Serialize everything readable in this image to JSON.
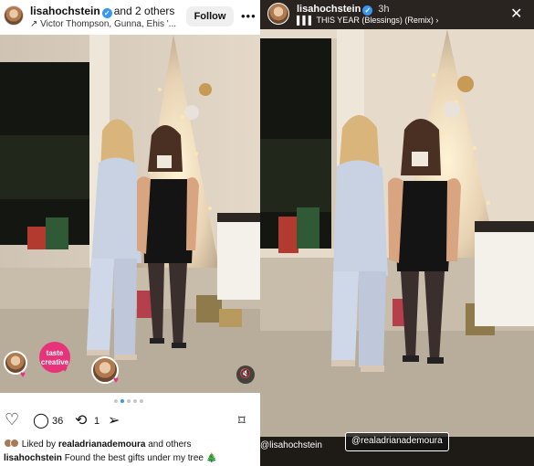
{
  "post": {
    "username": "lisahochstein",
    "others": "and 2 others",
    "subtitle": "Victor Thompson, Gunna, Ehis '...",
    "follow_label": "Follow",
    "more_icon": "more-horizontal-icon",
    "sticker_label": "taste\ncreative",
    "likes_count": "36",
    "comments_count": "",
    "reposts_count": "1",
    "liked_prefix": "Liked by",
    "liked_user": "realadrianademoura",
    "liked_suffix": "and others",
    "caption_user": "lisahochstein",
    "caption_text": "Found the best gifts under my tree 🎄",
    "carousel_total": 5,
    "carousel_active": 2
  },
  "story": {
    "username": "lisahochstein",
    "time": "3h",
    "music": "THIS YEAR (Blessings) (Remix)",
    "mention_1": "@lisahochstein",
    "mention_2": "@realadrianademoura"
  },
  "colors": {
    "verified": "#3897f0",
    "accent_pink": "#e6337a"
  }
}
